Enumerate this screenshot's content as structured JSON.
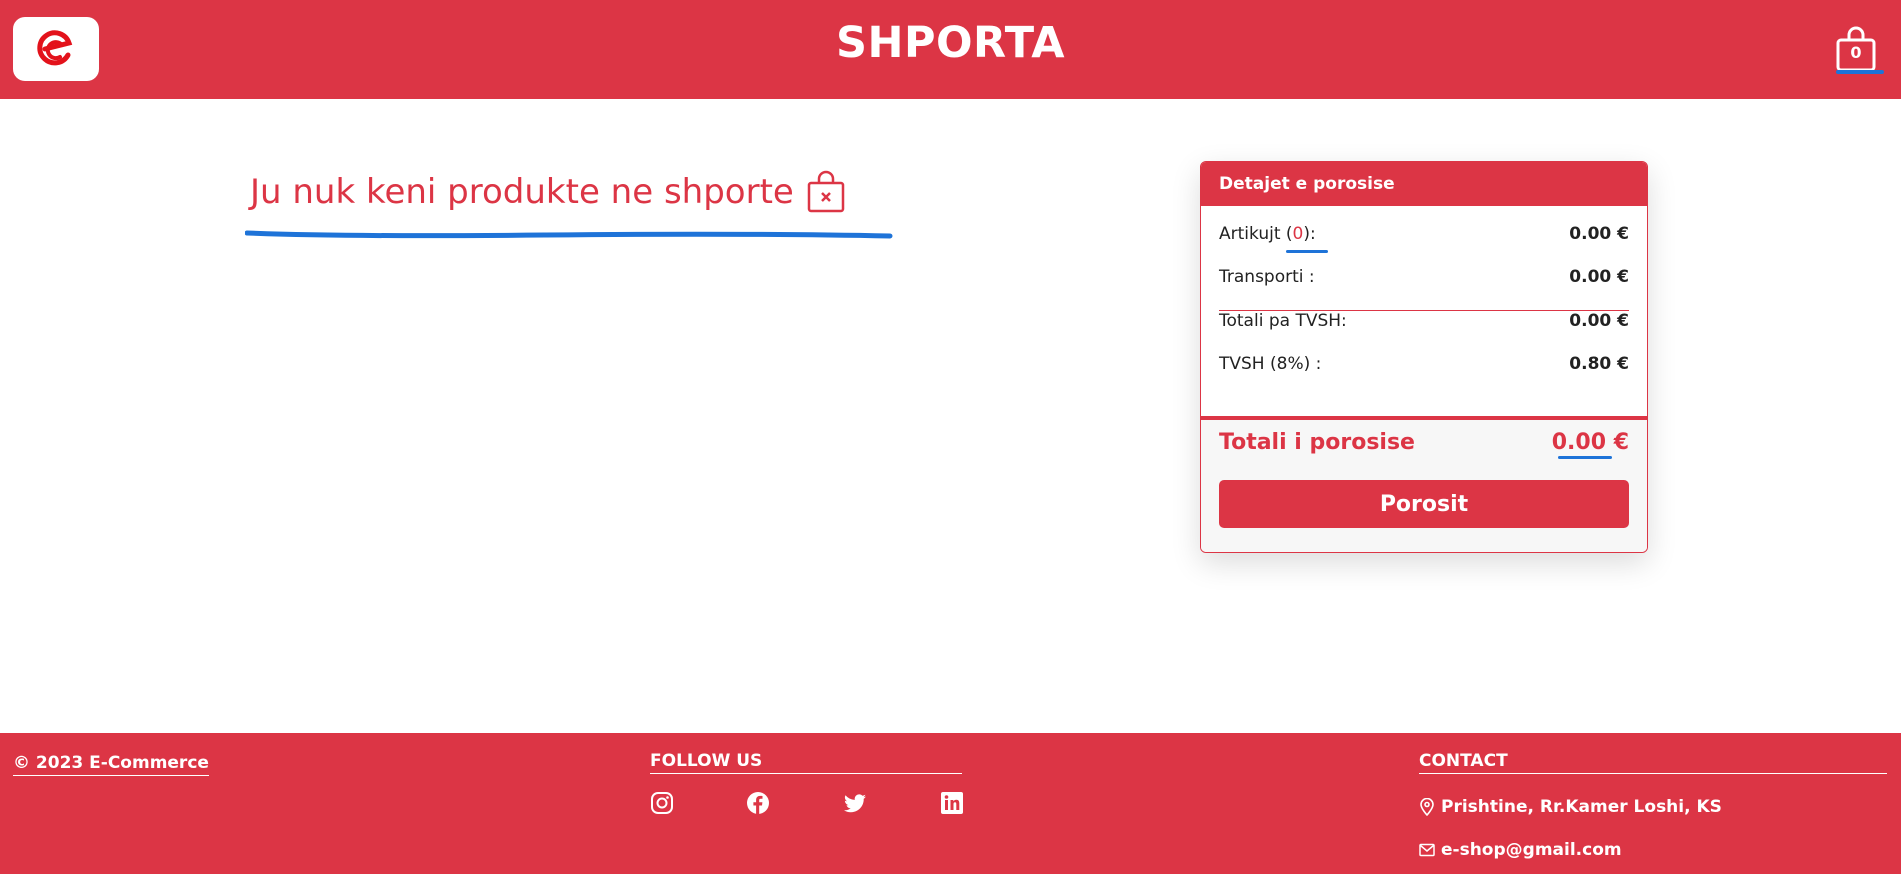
{
  "header": {
    "title": "SHPORTA",
    "logo_icon": "ecommerce-logo-icon",
    "cart_count": "0",
    "cart_icon": "shopping-bag-icon"
  },
  "main": {
    "empty_message": "Ju nuk keni produkte ne shporte",
    "empty_icon": "bag-x-icon"
  },
  "order": {
    "heading": "Detajet e porosise",
    "items_label_prefix": "Artikujt (",
    "items_count": "0",
    "items_label_suffix": "):",
    "items_value": "0.00 €",
    "shipping_label": "Transporti :",
    "shipping_value": "0.00 €",
    "subtotal_label": "Totali pa TVSH:",
    "subtotal_value": "0.00 €",
    "vat_label": "TVSH (8%) :",
    "vat_value": "0.80 €",
    "total_label": "Totali i porosise",
    "total_value": "0.00 €",
    "order_button": "Porosit"
  },
  "footer": {
    "copyright": "© 2023 E-Commerce",
    "follow_title": "FOLLOW US",
    "social_icons": [
      "instagram-icon",
      "facebook-icon",
      "twitter-icon",
      "linkedin-icon"
    ],
    "contact_title": "CONTACT",
    "address": "Prishtine, Rr.Kamer Loshi, KS",
    "email": "e-shop@gmail.com"
  },
  "colors": {
    "brand": "#dc3545",
    "annotation": "#1e73d8"
  }
}
